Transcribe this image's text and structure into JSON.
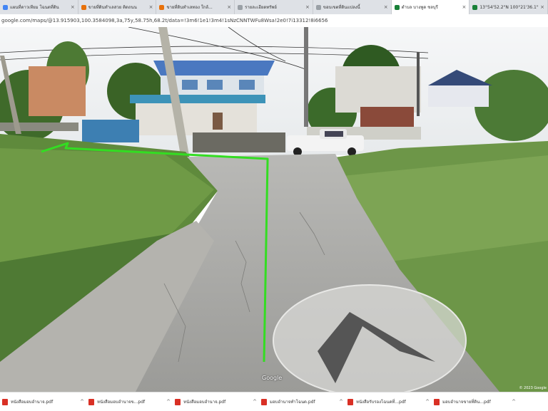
{
  "browser": {
    "tabs": [
      {
        "label": "แผนที่ดาวเทียม โฉนดที่ดิน",
        "color": "#4285f4",
        "active": false
      },
      {
        "label": "ขายที่ดินทำเลสวย ติดถนน",
        "color": "#e8710a",
        "active": false
      },
      {
        "label": "ขายที่ดินทำเลทอง ใกล้...",
        "color": "#e8710a",
        "active": false
      },
      {
        "label": "รายละเอียดทรัพย์",
        "color": "#9aa0a6",
        "active": false
      },
      {
        "label": "ขอบเขตที่ดินแปลงนี้",
        "color": "#9aa0a6",
        "active": false
      },
      {
        "label": "ตำบล บางพูด ชลบุรี",
        "color": "#188038",
        "active": true
      },
      {
        "label": "13°54'52.2\"N 100°21'36.1\"",
        "color": "#188038",
        "active": false
      }
    ],
    "close_glyph": "×",
    "address": "google.com/maps/@13.915903,100.3584098,3a,75y,58.75h,68.2t/data=!3m6!1e1!3m4!1sNzCNNTWFu8Wsa!2e0!7i13312!8i6656"
  },
  "streetview": {
    "watermark": "Google",
    "copyright": "© 2023 Google"
  },
  "downloads": {
    "items": [
      {
        "name": "หนังสือมอบอำนาจ.pdf"
      },
      {
        "name": "หนังสือมอบอำนาจข...pdf"
      },
      {
        "name": "หนังสือมอบอำนาจ.pdf"
      },
      {
        "name": "มอบอำนาจทำโฉนด.pdf"
      },
      {
        "name": "หนังสือรับรองโฉนดที่...pdf"
      },
      {
        "name": "มอบอำนาจขายที่ดิน...pdf"
      }
    ],
    "chevron": "^"
  },
  "colors": {
    "route": "#33dd22",
    "sky": "#f2f4f6",
    "road": "#a9a9a6",
    "grass": "#5f8f3e"
  }
}
